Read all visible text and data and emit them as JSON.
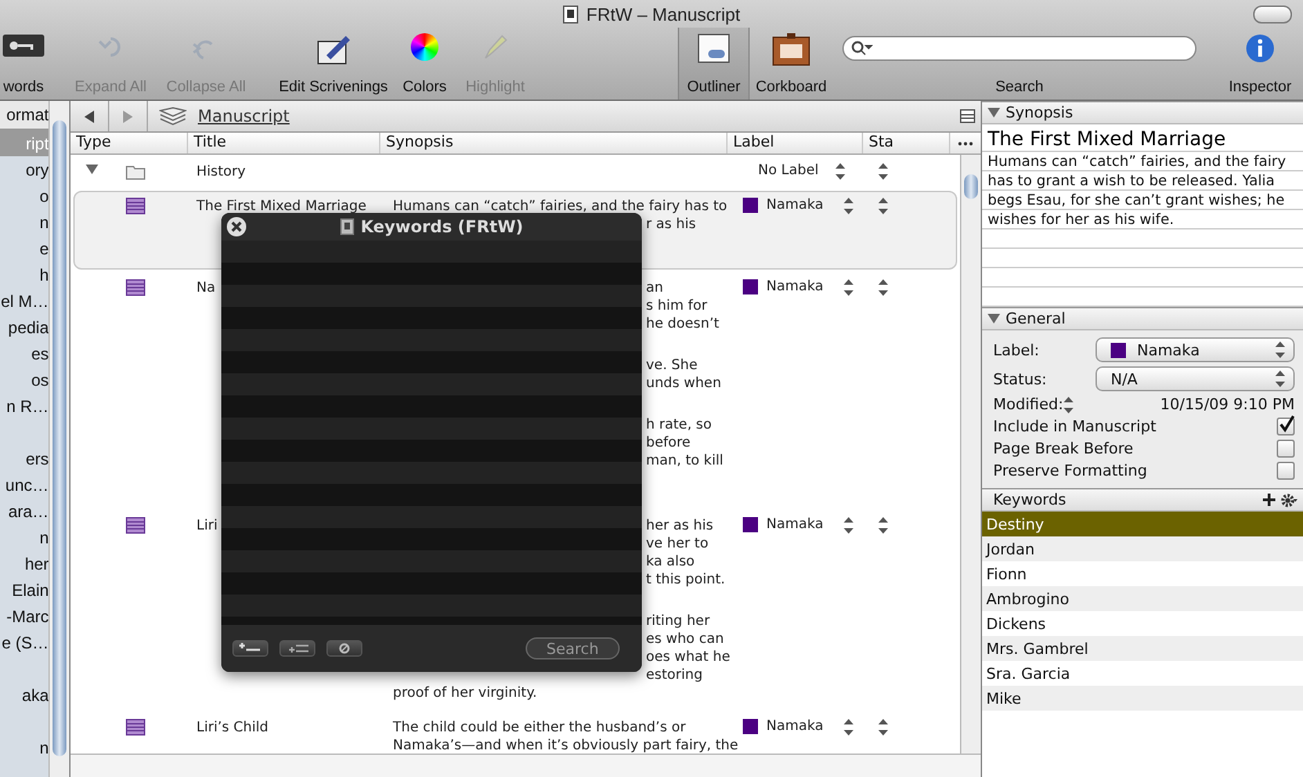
{
  "window": {
    "title": "FRtW – Manuscript"
  },
  "toolbar": [
    {
      "kind": "keywords",
      "label": "words",
      "disabled": false,
      "selected": false
    },
    {
      "kind": "expand",
      "label": "Expand All",
      "disabled": true,
      "selected": false
    },
    {
      "kind": "collapse",
      "label": "Collapse All",
      "disabled": true,
      "selected": false
    },
    {
      "kind": "scrivenings",
      "label": "Edit Scrivenings",
      "disabled": false,
      "selected": false
    },
    {
      "kind": "colors",
      "label": "Colors",
      "disabled": false,
      "selected": false
    },
    {
      "kind": "highlight",
      "label": "Highlight",
      "disabled": true,
      "selected": false
    },
    {
      "kind": "outliner",
      "label": "Outliner",
      "disabled": false,
      "selected": true
    },
    {
      "kind": "corkboard",
      "label": "Corkboard",
      "disabled": false,
      "selected": false
    },
    {
      "kind": "inspector",
      "label": "Inspector",
      "disabled": false,
      "selected": false
    }
  ],
  "search": {
    "label": "Search"
  },
  "binder": {
    "header": "ormat",
    "items": [
      {
        "kind": "item",
        "label": "ript",
        "selected": true
      },
      {
        "kind": "item",
        "label": "ory",
        "selected": false
      },
      {
        "kind": "item",
        "label": "o",
        "selected": false
      },
      {
        "kind": "item",
        "label": "n",
        "selected": false
      },
      {
        "kind": "item",
        "label": "e",
        "selected": false
      },
      {
        "kind": "item",
        "label": "h",
        "selected": false
      },
      {
        "kind": "item",
        "label": "el M…",
        "selected": false
      },
      {
        "kind": "item",
        "label": "pedia",
        "selected": false
      },
      {
        "kind": "item",
        "label": "es",
        "selected": false
      },
      {
        "kind": "item",
        "label": "os",
        "selected": false
      },
      {
        "kind": "item",
        "label": "n R…",
        "selected": false
      },
      {
        "kind": "blank"
      },
      {
        "kind": "item",
        "label": "ers",
        "selected": false
      },
      {
        "kind": "item",
        "label": "unc…",
        "selected": false
      },
      {
        "kind": "item",
        "label": "ara…",
        "selected": false
      },
      {
        "kind": "item",
        "label": "n",
        "selected": false
      },
      {
        "kind": "item",
        "label": "her",
        "selected": false
      },
      {
        "kind": "item",
        "label": "Elain",
        "selected": false
      },
      {
        "kind": "item",
        "label": "-Marc",
        "selected": false
      },
      {
        "kind": "item",
        "label": "e (S…",
        "selected": false
      },
      {
        "kind": "blank"
      },
      {
        "kind": "item",
        "label": "aka",
        "selected": false
      },
      {
        "kind": "blank"
      },
      {
        "kind": "item",
        "label": "n",
        "selected": false
      }
    ]
  },
  "editor": {
    "path": "Manuscript",
    "columns": [
      "Type",
      "Title",
      "Synopsis",
      "Label",
      "Sta"
    ],
    "rows": [
      {
        "kind": "folder",
        "expanded": true,
        "selected": false,
        "title": "History",
        "label": "No Label",
        "synopsis": []
      },
      {
        "kind": "text",
        "selected": true,
        "title": "The First Mixed Marriage",
        "label": "Namaka",
        "color": "#4b0082",
        "synopsis": [
          [
            {
              "text": "Humans can “catch” fairies, and the fairy has to",
              "covered_start": false
            },
            {
              "text": "r as his",
              "covered_start": true
            }
          ]
        ]
      },
      {
        "kind": "text",
        "selected": false,
        "title": "Na",
        "label": "Namaka",
        "color": "#4b0082",
        "synopsis": [
          [
            {
              "text": "an",
              "covered_start": true
            },
            {
              "text": "s him for",
              "covered_start": true
            },
            {
              "text": "he doesn’t",
              "covered_start": true
            }
          ],
          [
            {
              "text": "ve.  She",
              "covered_start": true
            },
            {
              "text": "unds when",
              "covered_start": true
            }
          ],
          [
            {
              "text": "h rate, so",
              "covered_start": true
            },
            {
              "text": "before",
              "covered_start": true
            },
            {
              "text": "man, to kill",
              "covered_start": true
            }
          ]
        ]
      },
      {
        "kind": "text",
        "selected": false,
        "title": "Liri",
        "label": "Namaka",
        "color": "#4b0082",
        "synopsis": [
          [
            {
              "text": "her as his",
              "covered_start": true
            },
            {
              "text": "ve her to",
              "covered_start": true
            },
            {
              "text": "ka also",
              "covered_start": true
            },
            {
              "text": "t this point.",
              "covered_start": true
            }
          ],
          [
            {
              "text": "riting her",
              "covered_start": true
            },
            {
              "text": "es who can",
              "covered_start": true
            },
            {
              "text": "oes what he",
              "covered_start": true
            },
            {
              "text": "estoring",
              "covered_start": true
            },
            {
              "text": "proof of her virginity.",
              "covered_start": false
            }
          ]
        ]
      },
      {
        "kind": "text",
        "selected": false,
        "title": "Liri’s Child",
        "label": "Namaka",
        "color": "#4b0082",
        "synopsis": [
          [
            {
              "text": "The child could be either the husband’s or",
              "covered_start": false
            },
            {
              "text": "Namaka’s—and when it’s obviously part fairy, the",
              "covered_start": false
            }
          ]
        ]
      }
    ]
  },
  "keywords_panel": {
    "title": "Keywords (FRtW)",
    "search_button": "Search"
  },
  "inspector": {
    "synopsis": {
      "heading": "Synopsis",
      "title": "The First Mixed Marriage",
      "text": "Humans can “catch” fairies, and the fairy has to grant a wish to be released.  Yalia begs Esau, for she can’t grant wishes; he wishes for her as his wife."
    },
    "general": {
      "heading": "General",
      "label": {
        "caption": "Label:",
        "value": "Namaka",
        "color": "#4b0082"
      },
      "status_caption": "Status:",
      "status_value": "N/A",
      "modified_caption": "Modified:",
      "modified_value": "10/15/09 9:10 PM",
      "options": [
        {
          "label": "Include in Manuscript",
          "checked": true
        },
        {
          "label": "Page Break Before",
          "checked": false
        },
        {
          "label": "Preserve Formatting",
          "checked": false
        }
      ]
    },
    "keywords": {
      "heading": "Keywords",
      "items": [
        {
          "label": "Destiny",
          "selected": true
        },
        {
          "label": "Jordan",
          "selected": false
        },
        {
          "label": "Fionn",
          "selected": false
        },
        {
          "label": "Ambrogino",
          "selected": false
        },
        {
          "label": "Dickens",
          "selected": false
        },
        {
          "label": "Mrs. Gambrel",
          "selected": false
        },
        {
          "label": "Sra. Garcia",
          "selected": false
        },
        {
          "label": "Mike",
          "selected": false
        }
      ]
    }
  }
}
